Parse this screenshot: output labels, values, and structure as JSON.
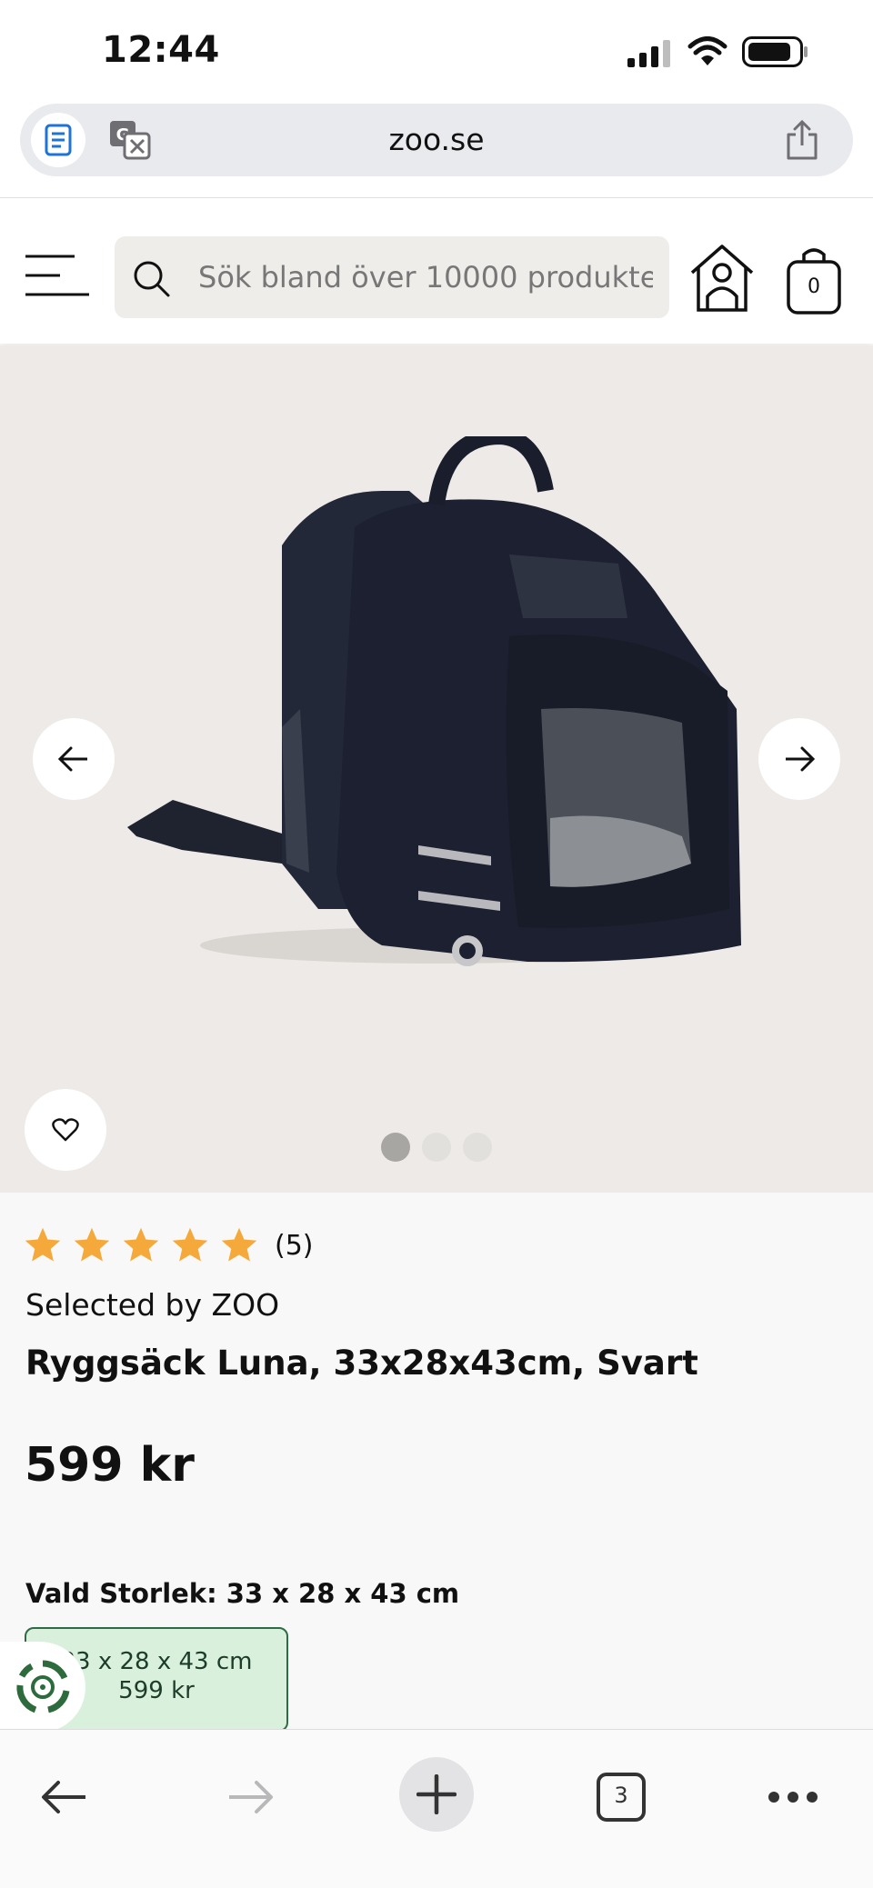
{
  "status_bar": {
    "time": "12:44",
    "icons": [
      "cellular-signal-icon",
      "wifi-icon",
      "battery-icon"
    ]
  },
  "browser": {
    "url": "zoo.se",
    "icons": [
      "reader-icon",
      "translate-icon",
      "share-icon"
    ]
  },
  "header": {
    "search_placeholder": "Sök bland över 10000 produkter",
    "cart_count": "0",
    "icons": [
      "menu-icon",
      "search-icon",
      "doghouse-account-icon",
      "shopping-bag-icon"
    ]
  },
  "gallery": {
    "image_count": 3,
    "active_index": 0,
    "icons": [
      "arrow-left-icon",
      "arrow-right-icon",
      "heart-icon"
    ]
  },
  "product": {
    "rating_stars": 5,
    "review_count": "(5)",
    "brand": "Selected by ZOO",
    "title": "Ryggsäck Luna, 33x28x43cm, Svart",
    "price": "599 kr",
    "size_label": "Vald Storlek: 33 x 28 x 43 cm",
    "size_option": {
      "size": "33 x 28 x 43 cm",
      "price": "599 kr"
    }
  },
  "toolbar": {
    "tab_count": "3",
    "icons": [
      "back-arrow-icon",
      "forward-arrow-icon",
      "plus-icon",
      "tabs-icon",
      "more-icon"
    ]
  },
  "colors": {
    "star": "#f5a93a",
    "gallery_bg": "#edeae7",
    "size_option_bg": "#d8f0dc",
    "size_option_border": "#2f6b45",
    "eco_green": "#2e6b3c"
  }
}
